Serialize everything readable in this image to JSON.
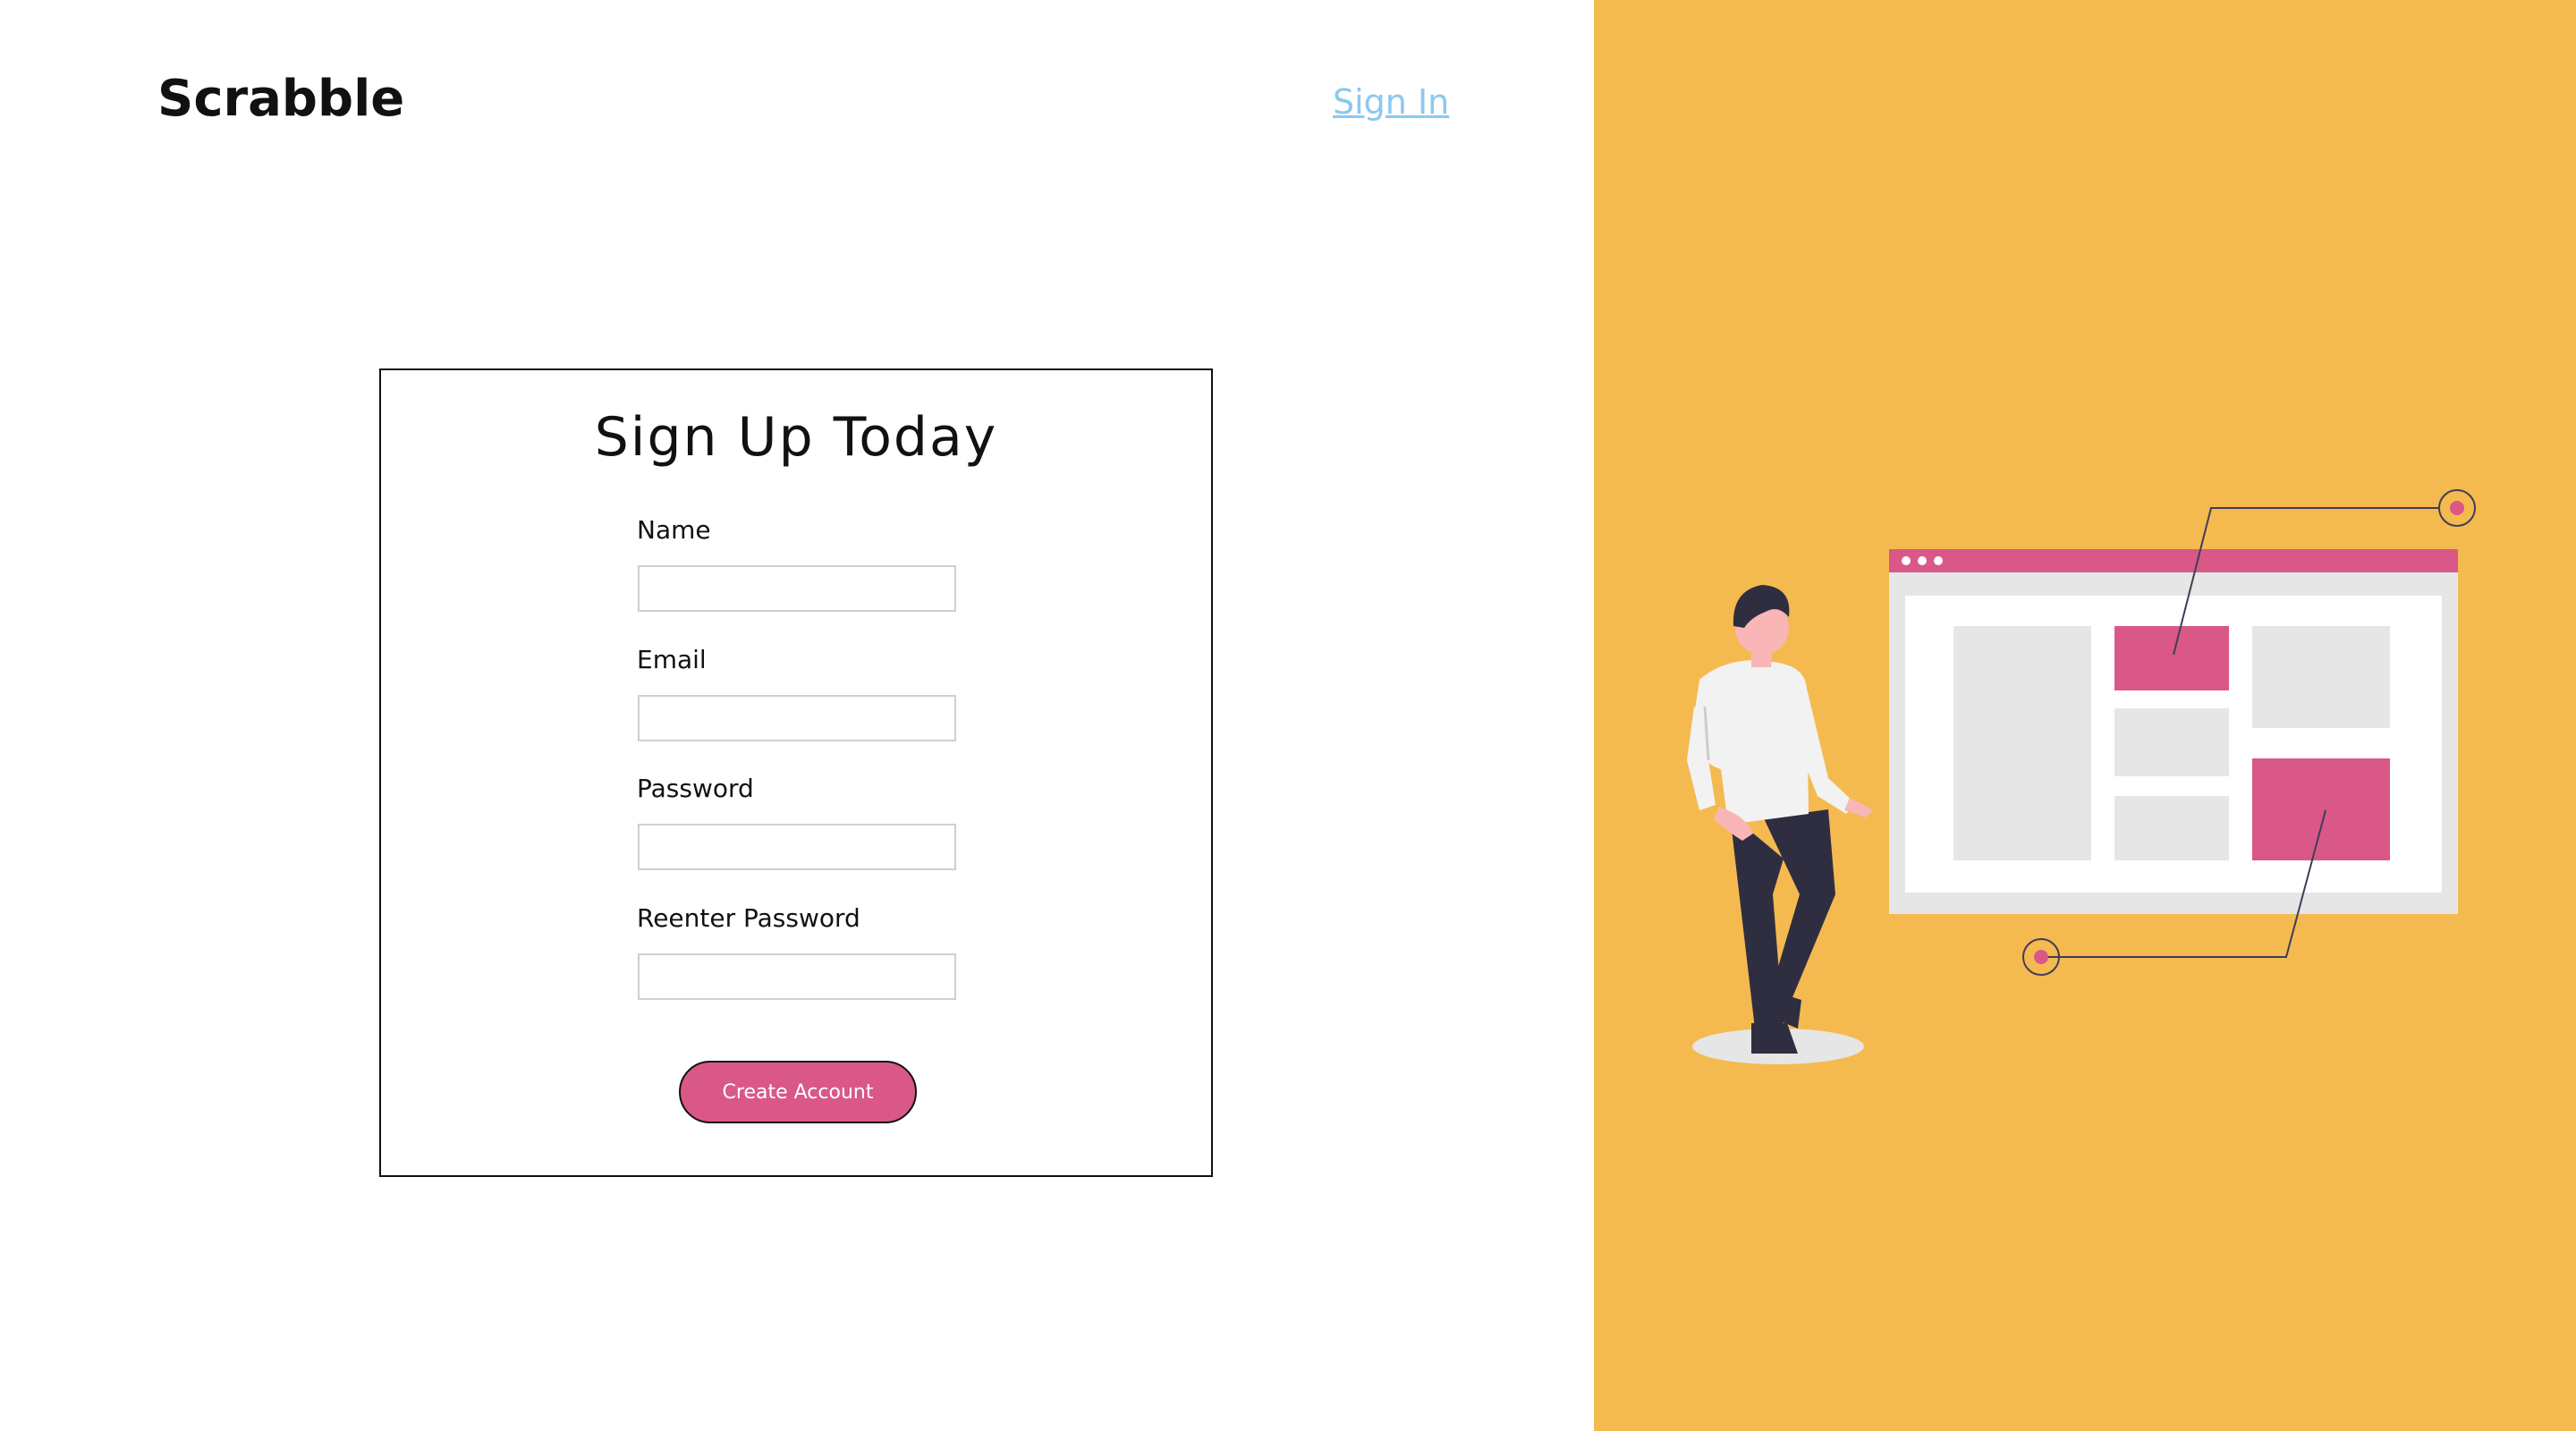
{
  "header": {
    "logo": "Scrabble",
    "signin_label": "Sign In"
  },
  "signup_form": {
    "title": "Sign Up Today",
    "fields": [
      {
        "label": "Name",
        "value": "",
        "placeholder": ""
      },
      {
        "label": "Email",
        "value": "",
        "placeholder": ""
      },
      {
        "label": "Password",
        "value": "",
        "placeholder": ""
      },
      {
        "label": "Reenter Password",
        "value": "",
        "placeholder": ""
      }
    ],
    "submit_label": "Create Account"
  },
  "colors": {
    "accent_pink": "#d95887",
    "panel_yellow": "#f4ba4f",
    "link_blue": "#8cc8f0",
    "text_dark": "#111111"
  },
  "illustration": {
    "icon": "person-with-browser-window-illustration"
  }
}
